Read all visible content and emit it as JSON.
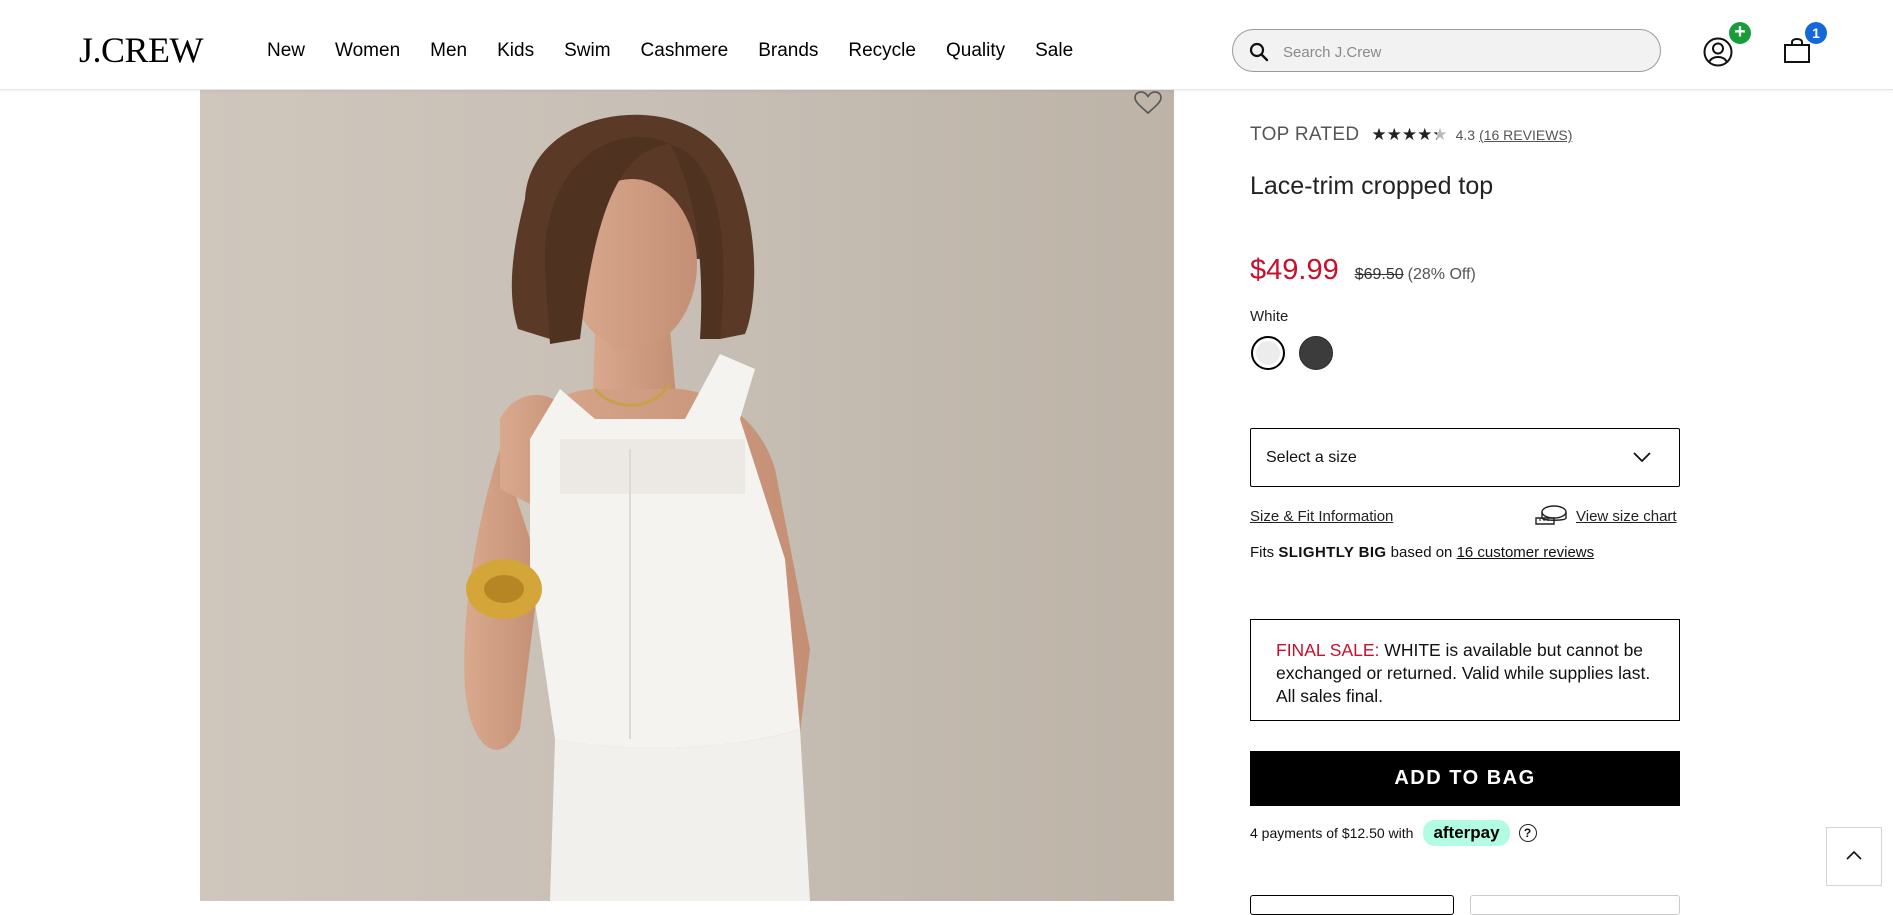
{
  "header": {
    "logo": "J.CREW",
    "nav": [
      "New",
      "Women",
      "Men",
      "Kids",
      "Swim",
      "Cashmere",
      "Brands",
      "Recycle",
      "Quality",
      "Sale"
    ],
    "search_placeholder": "Search J.Crew",
    "account_badge": "+",
    "bag_count": "1"
  },
  "product": {
    "top_rated": "TOP RATED",
    "rating": 4.3,
    "rating_text": "4.3",
    "reviews_link": "(16 REVIEWS)",
    "title": "Lace-trim cropped top",
    "price": "$49.99",
    "original_price": "$69.50",
    "discount": "(28% Off)",
    "color_label": "White",
    "swatches": [
      {
        "name": "White",
        "color": "#ececec",
        "selected": true
      },
      {
        "name": "Black",
        "color": "#3c3c3c",
        "selected": false
      }
    ],
    "size_select": "Select a size",
    "size_fit_link": "Size & Fit Information",
    "size_chart_link": "View size chart",
    "fits_prefix": "Fits",
    "fits_value": "SLIGHTLY BIG",
    "fits_middle": "based on",
    "fits_reviews": "16 customer reviews",
    "final_sale_label": "FINAL SALE:",
    "final_sale_text": "WHITE is available but cannot be exchanged or returned. Valid while supplies last. All sales final.",
    "add_to_bag": "ADD TO BAG",
    "afterpay_text": "4 payments of $12.50 with",
    "afterpay_brand": "afterpay",
    "help_icon": "?"
  },
  "colors": {
    "sale_red": "#c8102e",
    "afterpay_mint": "#b2fce4",
    "account_badge": "#1a9c3a",
    "bag_badge": "#1568d8"
  }
}
